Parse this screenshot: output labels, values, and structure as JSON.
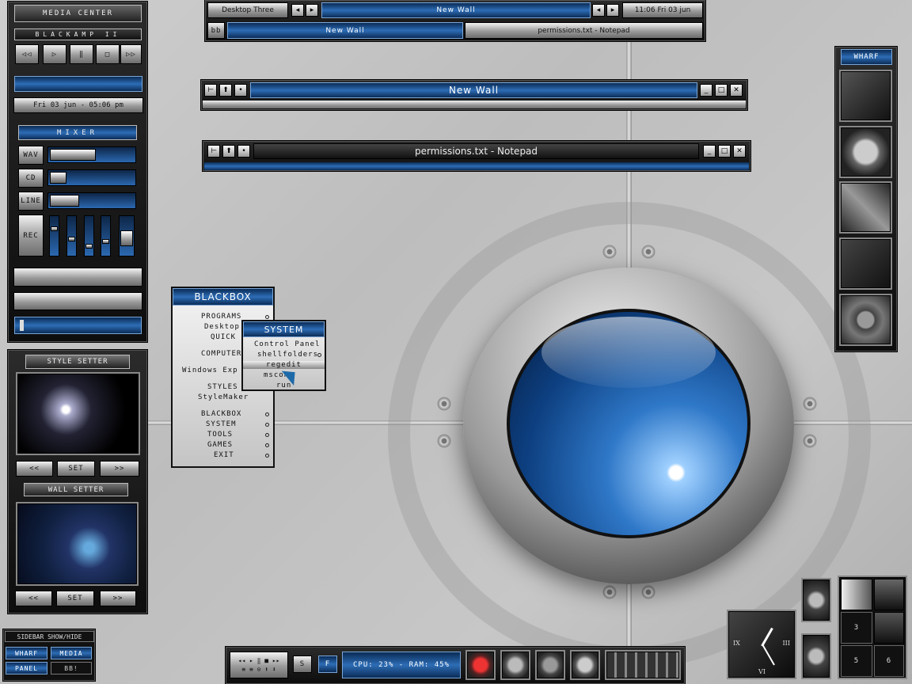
{
  "media_center": {
    "title": "MEDIA CENTER"
  },
  "blackamp": {
    "title": "BLACKAMP II",
    "controls": [
      "prev",
      "play",
      "pause",
      "stop",
      "next"
    ]
  },
  "datetime_widget": {
    "text": "Fri 03 jun - 05:06 pm"
  },
  "mixer": {
    "title": "MIXER",
    "channels": [
      {
        "label": "WAV",
        "level": 0.55
      },
      {
        "label": "CD",
        "level": 0.2
      },
      {
        "label": "LINE",
        "level": 0.35
      }
    ],
    "rec_label": "REC",
    "vertical_levels": [
      0.7,
      0.4,
      0.2,
      0.35,
      0.6
    ]
  },
  "style_setter": {
    "title": "STYLE SETTER",
    "prev": "<<",
    "set": "SET",
    "next": ">>"
  },
  "wall_setter": {
    "title": "WALL SETTER",
    "prev": "<<",
    "set": "SET",
    "next": ">>"
  },
  "sidebar": {
    "title": "SIDEBAR SHOW/HIDE",
    "buttons": [
      "WHARF",
      "MEDIA",
      "PANEL",
      "BB!"
    ]
  },
  "toolbar": {
    "workspace": "Desktop Three",
    "window_title": "New Wall",
    "clock": "11:06 Fri 03 jun",
    "tasks": [
      "New Wall",
      "permissions.txt - Notepad"
    ],
    "bb_label": "bb"
  },
  "window_newwall": {
    "title": "New Wall"
  },
  "window_notepad": {
    "title": "permissions.txt - Notepad"
  },
  "bbmenu": {
    "title": "BLACKBOX",
    "items": [
      "PROGRAMS",
      "Desktop",
      "QUICK",
      "COMPUTER",
      "Windows Exp",
      "STYLES",
      "StyleMaker",
      "BLACKBOX",
      "SYSTEM",
      "TOOLS",
      "GAMES",
      "EXIT"
    ]
  },
  "system_menu": {
    "title": "SYSTEM",
    "items": [
      "Control Panel",
      "shellfolders",
      "regedit",
      "mscon",
      "run"
    ]
  },
  "wharf": {
    "title": "WHARF"
  },
  "bottom_bar": {
    "s_label": "S",
    "f_label": "F",
    "stats": "CPU: 23% - RAM: 45%"
  },
  "pager": {
    "desktops": [
      "3",
      "5",
      "6"
    ]
  },
  "clock_widget": {
    "numerals": [
      "IX",
      "III",
      "VI"
    ]
  }
}
